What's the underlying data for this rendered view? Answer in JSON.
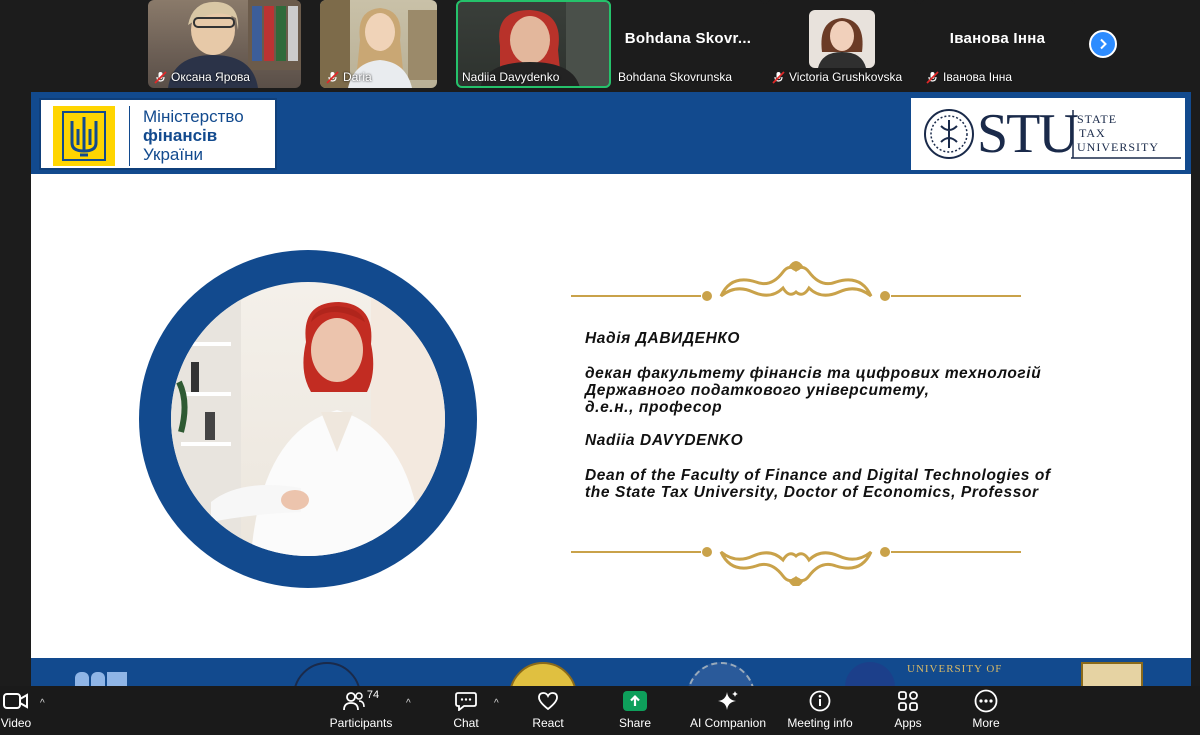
{
  "participants": [
    {
      "name": "Оксана Ярова",
      "muted": true
    },
    {
      "name": "Daria",
      "muted": true
    },
    {
      "name": "Nadiia Davydenko",
      "muted": false,
      "active": true
    },
    {
      "name": "Bohdana Skovrunska",
      "display_text": "Bohdana  Skovr...",
      "muted": false
    },
    {
      "name": "Victoria Grushkovska",
      "muted": true
    },
    {
      "name": "Іванова Інна",
      "display_text": "Іванова Інна",
      "muted": true
    }
  ],
  "slide": {
    "ministry": {
      "line1": "Міністерство",
      "line2": "фінансів",
      "line3": "України"
    },
    "stu": {
      "letters": "STU",
      "line1": "STATE",
      "line2": "TAX",
      "line3": "UNIVERSITY"
    },
    "bio": {
      "name_ua": "Надія ДАВИДЕНКО",
      "title_ua_1": "декан факультету фінансів та цифрових технологій",
      "title_ua_2": "Державного податкового університету,",
      "title_ua_3": "д.е.н., професор",
      "name_en": "Nadiia DAVYDENKO",
      "title_en_1": "Dean of the Faculty of Finance and Digital Technologies of",
      "title_en_2": "the State Tax University, Doctor of Economics, Professor"
    },
    "footer_text": "UNIVERSITY OF"
  },
  "toolbar": {
    "video": "Video",
    "participants": "Participants",
    "participants_count": "74",
    "chat": "Chat",
    "react": "React",
    "share": "Share",
    "ai_companion": "AI Companion",
    "meeting_info": "Meeting info",
    "apps": "Apps",
    "more": "More"
  },
  "colors": {
    "slide_blue": "#124a8e",
    "ministry_yellow": "#ffd500",
    "gold": "#c9a24a",
    "active_speaker": "#25c26b",
    "share_green": "#0e9f5b",
    "accent": "#2d8cff"
  }
}
